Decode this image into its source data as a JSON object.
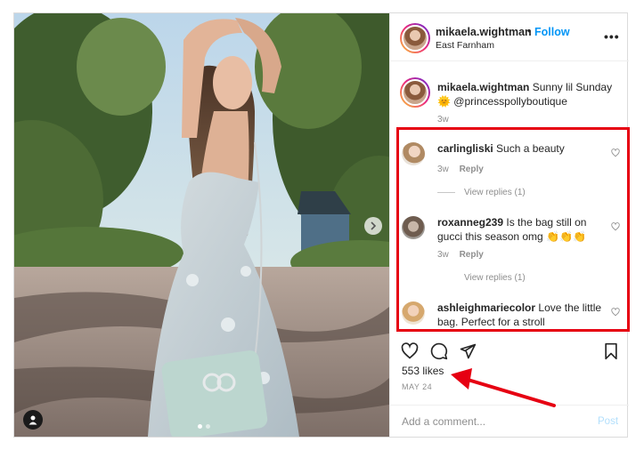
{
  "post": {
    "username": "mikaela.wightman",
    "separator": "•",
    "follow_label": "Follow",
    "location": "East Farnham",
    "more_label": "•••",
    "caption": {
      "username": "mikaela.wightman",
      "text": "Sunny lil Sunday",
      "emoji": "🌞",
      "mention": "@princesspollyboutique",
      "time": "3w"
    },
    "comments": [
      {
        "username": "carlingliski",
        "text": "Such a beauty",
        "time": "3w",
        "reply_label": "Reply",
        "view_replies": "View replies (1)"
      },
      {
        "username": "roxanneg239",
        "text_line1": "Is the bag still on",
        "text_line2": "gucci this season omg 👏👏👏",
        "time": "3w",
        "reply_label": "Reply",
        "view_replies": "View replies (1)"
      },
      {
        "username": "ashleighmariecolor",
        "text_line1": "Love the little",
        "text_line2": "bag. Perfect for a stroll"
      }
    ],
    "likes": "553 likes",
    "date": "MAY 24",
    "comment_placeholder": "Add a comment...",
    "post_label": "Post"
  },
  "colors": {
    "link_blue": "#0095f6",
    "annotation_red": "#e60012",
    "muted": "#8e8e8e"
  },
  "icons": {
    "more": "more-options-icon",
    "like": "heart-icon",
    "comment": "comment-icon",
    "share": "share-icon",
    "save": "bookmark-icon",
    "next": "chevron-right-icon",
    "tag": "user-tag-icon"
  }
}
